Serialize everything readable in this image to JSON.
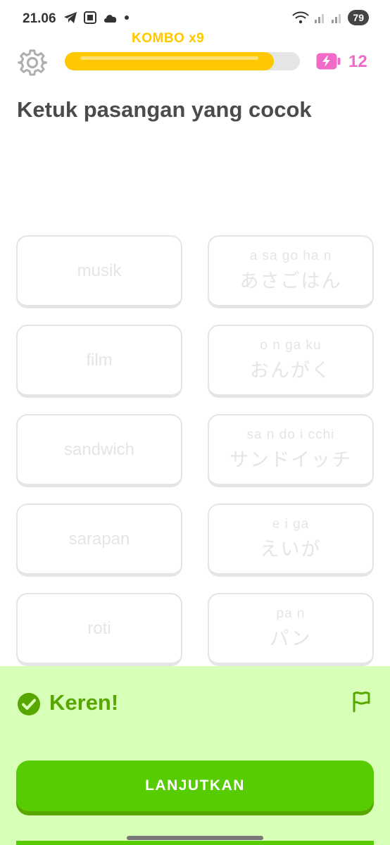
{
  "status_bar": {
    "time": "21.06",
    "battery": "79",
    "icons_left": [
      "telegram-icon",
      "screenshot-icon",
      "cloud-icon",
      "dot-icon"
    ],
    "icons_right": [
      "wifi-icon",
      "signal-icon",
      "signal-icon"
    ]
  },
  "header": {
    "combo": "KOMBO x9",
    "progress": 0.89,
    "energy_count": "12",
    "progress_color": "#ffc800",
    "energy_color": "#f06ac8"
  },
  "title": "Ketuk pasangan yang cocok",
  "left_tiles": [
    {
      "word": "musik"
    },
    {
      "word": "film"
    },
    {
      "word": "sandwich"
    },
    {
      "word": "sarapan"
    },
    {
      "word": "roti"
    }
  ],
  "right_tiles": [
    {
      "reading": "a sa go ha n",
      "kana": "あさごはん"
    },
    {
      "reading": "o n ga ku",
      "kana": "おんがく"
    },
    {
      "reading": "sa n do i cchi",
      "kana": "サンドイッチ"
    },
    {
      "reading": "e i ga",
      "kana": "えいが"
    },
    {
      "reading": "pa n",
      "kana": "パン"
    }
  ],
  "feedback": {
    "text": "Keren!",
    "button": "LANJUTKAN",
    "bg_color": "#d7ffb8",
    "accent_color": "#58cc02"
  }
}
